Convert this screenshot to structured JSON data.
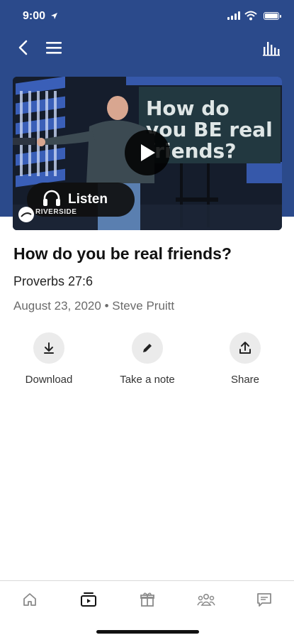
{
  "status_bar": {
    "time": "9:00"
  },
  "header": {
    "back_icon": "chevron-left-icon",
    "menu_icon": "hamburger-menu-icon",
    "right_icon": "bar-chart-icon",
    "background_color": "#2b4a8b"
  },
  "media": {
    "slide_text": "How do you BE real friends?",
    "listen_label": "Listen",
    "logo_text": "RIVERSIDE"
  },
  "sermon": {
    "title": "How do you be real friends?",
    "scripture": "Proverbs 27:6",
    "date": "August 23, 2020",
    "separator": "•",
    "speaker": "Steve Pruitt"
  },
  "actions": [
    {
      "label": "Download",
      "icon": "download-icon"
    },
    {
      "label": "Take a note",
      "icon": "pencil-icon"
    },
    {
      "label": "Share",
      "icon": "share-icon"
    }
  ],
  "tab_bar": [
    {
      "icon": "home-icon",
      "active": false
    },
    {
      "icon": "media-icon",
      "active": true
    },
    {
      "icon": "gift-icon",
      "active": false
    },
    {
      "icon": "people-icon",
      "active": false
    },
    {
      "icon": "chat-icon",
      "active": false
    }
  ]
}
